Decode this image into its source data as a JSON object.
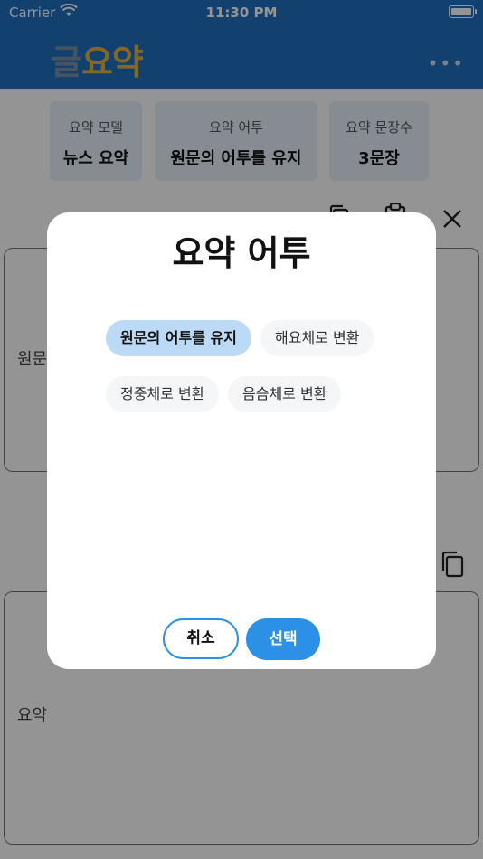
{
  "status_bar": {
    "carrier": "Carrier",
    "time": "11:30 PM"
  },
  "header": {
    "logo_part1": "글",
    "logo_part2": "요약",
    "more": "•••"
  },
  "settings": [
    {
      "label": "요약 모델",
      "value": "뉴스 요약"
    },
    {
      "label": "요약 어투",
      "value": "원문의 어투를 유지"
    },
    {
      "label": "요약 문장수",
      "value": "3문장"
    }
  ],
  "editor": {
    "source_placeholder": "원문",
    "summary_placeholder": "요약"
  },
  "modal": {
    "title": "요약 어투",
    "options": [
      {
        "label": "원문의 어투를 유지",
        "selected": true
      },
      {
        "label": "해요체로 변환",
        "selected": false
      },
      {
        "label": "정중체로 변환",
        "selected": false
      },
      {
        "label": "음슴체로 변환",
        "selected": false
      }
    ],
    "cancel_label": "취소",
    "select_label": "선택"
  },
  "colors": {
    "header": "#1f71c2",
    "accent": "#2b90e6",
    "selected_chip": "#bcdaf6"
  }
}
